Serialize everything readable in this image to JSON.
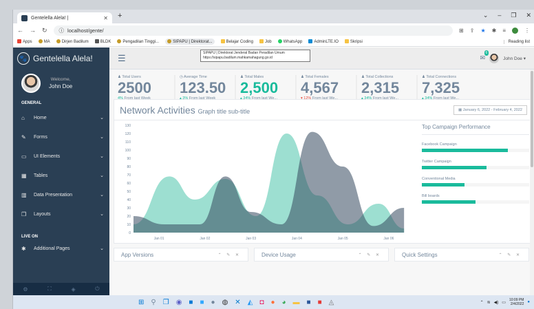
{
  "browser": {
    "tab_title": "Gentelella Alela! |",
    "url": "localhost/gente/",
    "bookmarks": [
      "Apps",
      "MA",
      "Dirjen Badilum",
      "BLDK",
      "Pengadilan Tinggi...",
      "SIPAPU | Direktorat...",
      "Belajar Coding",
      "Job",
      "WhatsApp",
      "AdminLTE.IO",
      "Skripsi"
    ],
    "reading_list": "Reading list",
    "tooltip_line1": "SIPAPU | Direktorat Jenderal Badan Peradilan Umum",
    "tooltip_line2": "https://sipapu.badilum.mahkamahagung.go.id"
  },
  "sidebar": {
    "brand": "Gentelella Alela!",
    "welcome": "Welcome,",
    "user": "John Doe",
    "section_general": "GENERAL",
    "items": [
      {
        "label": "Home",
        "icon": "home-icon"
      },
      {
        "label": "Forms",
        "icon": "edit-icon"
      },
      {
        "label": "UI Elements",
        "icon": "desktop-icon"
      },
      {
        "label": "Tables",
        "icon": "table-icon"
      },
      {
        "label": "Data Presentation",
        "icon": "bar-chart-icon"
      },
      {
        "label": "Layouts",
        "icon": "clone-icon"
      }
    ],
    "section_live": "LIVE ON",
    "additional": "Additional Pages"
  },
  "topnav": {
    "mail_count": "6",
    "username": "John Doe ▾"
  },
  "tiles": [
    {
      "title": "Total Users",
      "count": "2500",
      "change": "4%",
      "change_text": " From last Week",
      "dir": "up",
      "green": false
    },
    {
      "title": "Average Time",
      "count": "123.50",
      "change": "3%",
      "change_text": " From last Week",
      "dir": "up",
      "green": false
    },
    {
      "title": "Total Males",
      "count": "2,500",
      "change": "34%",
      "change_text": " From last We...",
      "dir": "up",
      "green": true
    },
    {
      "title": "Total Females",
      "count": "4,567",
      "change": "12%",
      "change_text": " From last We...",
      "dir": "down",
      "green": false
    },
    {
      "title": "Total Collections",
      "count": "2,315",
      "change": "34%",
      "change_text": " From last We...",
      "dir": "up",
      "green": false
    },
    {
      "title": "Total Connections",
      "count": "7,325",
      "change": "34%",
      "change_text": " From last We...",
      "dir": "up",
      "green": false
    }
  ],
  "panel": {
    "title": "Network Activities",
    "subtitle": "Graph title sub-title",
    "daterange": "January 6, 2022 - February 4, 2022"
  },
  "campaign": {
    "title": "Top Campaign Performance",
    "items": [
      {
        "label": "Facebook Campaign",
        "pct": 80
      },
      {
        "label": "Twitter Campaign",
        "pct": 60
      },
      {
        "label": "Conventional Media",
        "pct": 40
      },
      {
        "label": "Bill boards",
        "pct": 50
      }
    ]
  },
  "bottom_panels": [
    "App Versions",
    "Device Usage",
    "Quick Settings"
  ],
  "taskbar": {
    "time": "10:09 PM",
    "date": "2/4/2022"
  },
  "chart_data": {
    "type": "area",
    "x": [
      "Jan 01",
      "Jan 02",
      "Jan 03",
      "Jan 04",
      "Jan 05",
      "Jan 06"
    ],
    "ylim": [
      0,
      130
    ],
    "yticks": [
      0,
      10,
      20,
      30,
      40,
      50,
      60,
      70,
      80,
      90,
      100,
      110,
      120,
      130
    ],
    "series": [
      {
        "values_x": [
          0,
          0.7,
          1.2,
          1.8,
          2.4,
          3.0,
          3.6,
          4.2,
          4.8,
          5.3
        ],
        "values": [
          10,
          68,
          40,
          65,
          20,
          120,
          45,
          10,
          35,
          5
        ],
        "color": "#26b99a"
      },
      {
        "values_x": [
          0,
          0.6,
          1.3,
          1.8,
          2.3,
          2.9,
          3.5,
          4.1,
          4.7,
          5.3
        ],
        "values": [
          20,
          10,
          10,
          68,
          25,
          10,
          122,
          80,
          8,
          30
        ],
        "color": "#34495e"
      }
    ]
  }
}
